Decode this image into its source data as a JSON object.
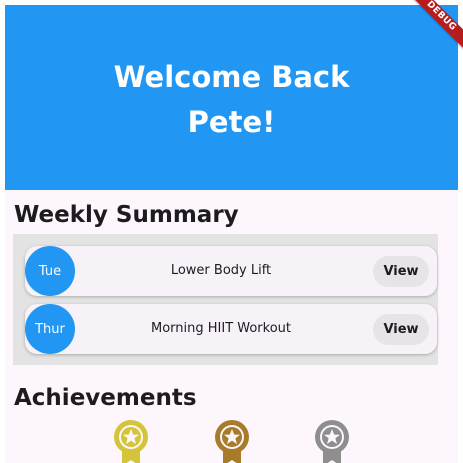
{
  "header": {
    "greeting_line1": "Welcome Back",
    "greeting_line2": "Pete!",
    "background_color": "#2196f3"
  },
  "debug_banner": {
    "label": "DEBUG"
  },
  "weekly_summary": {
    "title": "Weekly Summary",
    "items": [
      {
        "day": "Tue",
        "workout": "Lower Body Lift",
        "action_label": "View"
      },
      {
        "day": "Thur",
        "workout": "Morning HIIT Workout",
        "action_label": "View"
      }
    ]
  },
  "achievements": {
    "title": "Achievements",
    "medals": [
      {
        "icon": "gold-medal-icon",
        "color": "#d4c43a"
      },
      {
        "icon": "bronze-medal-icon",
        "color": "#a87b2a"
      },
      {
        "icon": "silver-medal-icon",
        "color": "#8e8e8e"
      }
    ]
  }
}
